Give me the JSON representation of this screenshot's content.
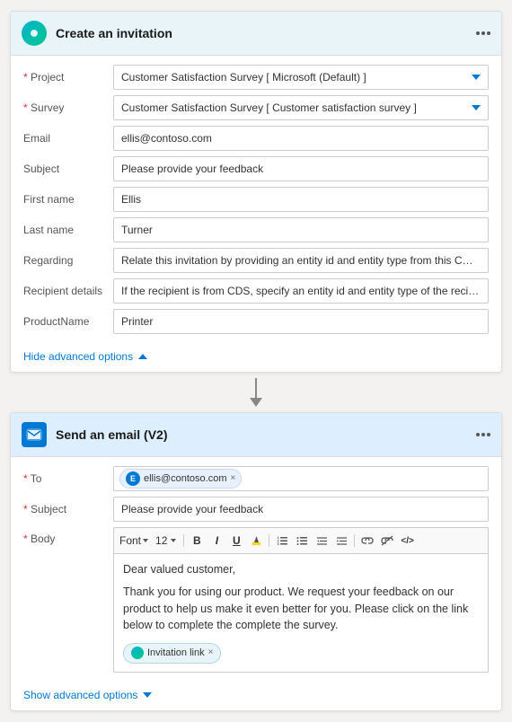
{
  "card1": {
    "title": "Create an invitation",
    "fields": {
      "project_label": "Project",
      "project_value": "Customer Satisfaction Survey [ Microsoft (Default) ]",
      "survey_label": "Survey",
      "survey_value": "Customer Satisfaction Survey [ Customer satisfaction survey ]",
      "email_label": "Email",
      "email_value": "ellis@contoso.com",
      "subject_label": "Subject",
      "subject_value": "Please provide your feedback",
      "firstname_label": "First name",
      "firstname_value": "Ellis",
      "lastname_label": "Last name",
      "lastname_value": "Turner",
      "regarding_label": "Regarding",
      "regarding_value": "Relate this invitation by providing an entity id and entity type from this CDS in t",
      "recipient_label": "Recipient details",
      "recipient_value": "If the recipient is from CDS, specify an entity id and entity type of the recipient",
      "productname_label": "ProductName",
      "productname_value": "Printer"
    },
    "hide_advanced": "Hide advanced options"
  },
  "card2": {
    "title": "Send an email (V2)",
    "fields": {
      "to_label": "To",
      "to_tag": "ellis@contoso.com",
      "to_tag_initial": "E",
      "subject_label": "Subject",
      "subject_value": "Please provide your feedback",
      "body_label": "Body",
      "toolbar": {
        "font_label": "Font",
        "font_size": "12",
        "bold": "B",
        "italic": "I",
        "underline": "U"
      },
      "body_line1": "Dear valued customer,",
      "body_line2": "Thank you for using our product. We request your feedback on our product to help us make it even better for you. Please click on the link below to complete the complete the survey.",
      "invitation_link_label": "Invitation link"
    },
    "show_advanced": "Show advanced options"
  }
}
